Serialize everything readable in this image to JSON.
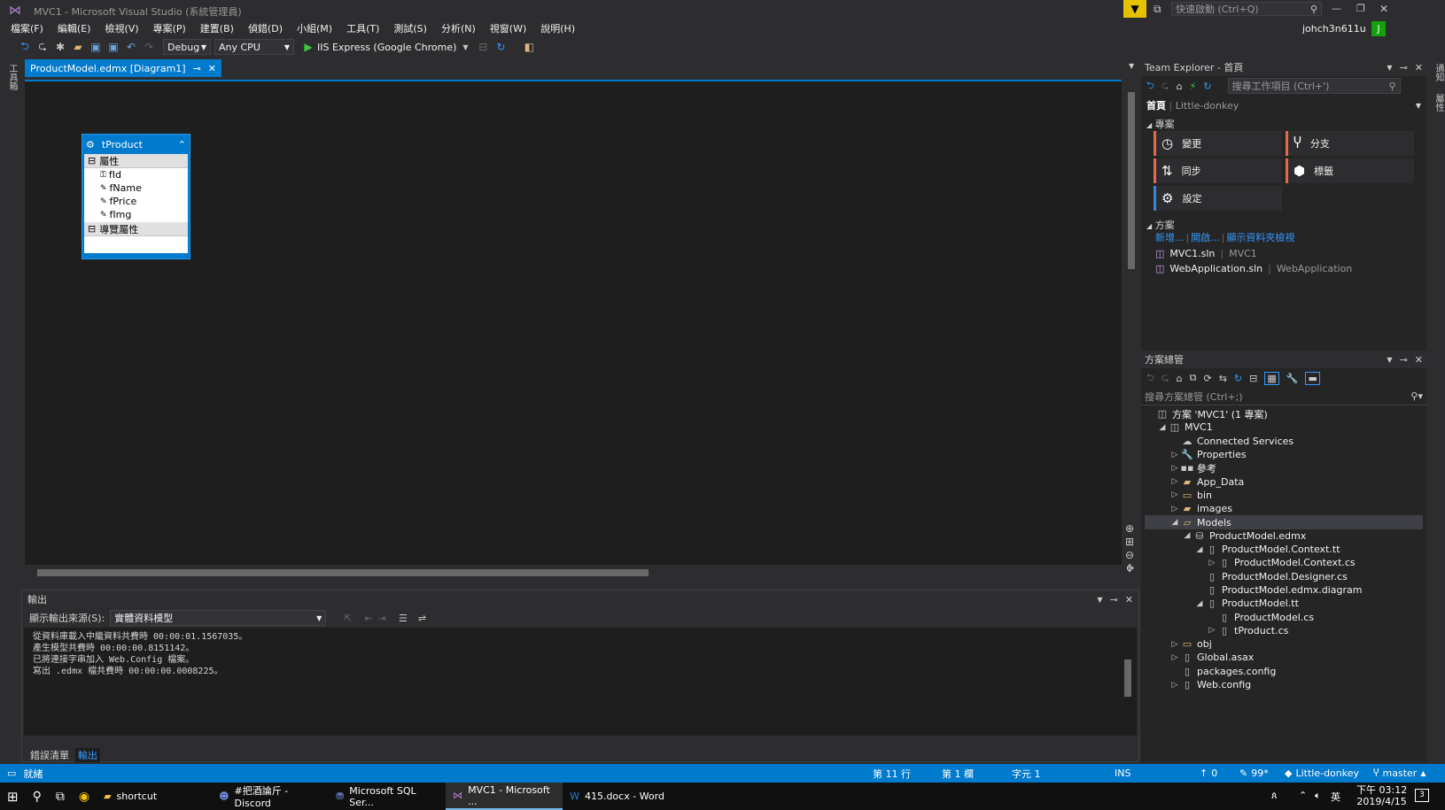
{
  "window": {
    "title": "MVC1 - Microsoft Visual Studio (系統管理員)",
    "quick_launch": "快速啟動 (Ctrl+Q)",
    "user": "johch3n611u",
    "user_initial": "J"
  },
  "menu": [
    "檔案(F)",
    "編輯(E)",
    "檢視(V)",
    "專案(P)",
    "建置(B)",
    "偵錯(D)",
    "小組(M)",
    "工具(T)",
    "測試(S)",
    "分析(N)",
    "視窗(W)",
    "說明(H)"
  ],
  "toolbar": {
    "config": "Debug",
    "platform": "Any CPU",
    "run": "IIS Express (Google Chrome)"
  },
  "left_strip": "工具箱",
  "document_tab": {
    "label": "ProductModel.edmx [Diagram1]"
  },
  "entity": {
    "name": "tProduct",
    "section_props": "屬性",
    "props": [
      "fId",
      "fName",
      "fPrice",
      "fImg"
    ],
    "section_nav": "導覽屬性"
  },
  "output": {
    "title": "輸出",
    "source_label": "顯示輸出來源(S):",
    "source_value": "實體資料模型",
    "lines": [
      "從資料庫載入中繼資料共費時 00:00:01.1567035。",
      "產生模型共費時 00:00:00.8151142。",
      "已將連接字串加入 Web.Config 檔案。",
      "寫出 .edmx 檔共費時 00:00:00.0008225。"
    ],
    "tabs": [
      "錯誤清單",
      "輸出"
    ]
  },
  "team_explorer": {
    "title": "Team Explorer - 首頁",
    "search_placeholder": "搜尋工作項目 (Ctrl+')",
    "home": "首頁",
    "repo": "Little-donkey",
    "project_header": "專案",
    "tiles": [
      {
        "label": "變更",
        "icon": "clock-icon",
        "color": "#e8694a"
      },
      {
        "label": "分支",
        "icon": "branch-icon",
        "color": "#e8694a"
      },
      {
        "label": "同步",
        "icon": "sync-icon",
        "color": "#e8694a"
      },
      {
        "label": "標籤",
        "icon": "tag-icon",
        "color": "#e8694a"
      },
      {
        "label": "設定",
        "icon": "gear-icon",
        "color": "#3b87d6"
      }
    ],
    "solutions_header": "方案",
    "sol_links": [
      "新增...",
      "開啟...",
      "顯示資料夾檢視"
    ],
    "solutions": [
      {
        "name": "MVC1.sln",
        "path": "MVC1"
      },
      {
        "name": "WebApplication.sln",
        "path": "WebApplication"
      }
    ]
  },
  "solution_explorer": {
    "title": "方案總管",
    "search_placeholder": "搜尋方案總管 (Ctrl+;)",
    "items": [
      {
        "label": "方案 'MVC1' (1 專案)",
        "depth": 0,
        "exp": "",
        "icon": "solution-icon"
      },
      {
        "label": "MVC1",
        "depth": 1,
        "exp": "◢",
        "icon": "project-icon"
      },
      {
        "label": "Connected Services",
        "depth": 2,
        "exp": "",
        "icon": "cloud-icon"
      },
      {
        "label": "Properties",
        "depth": 2,
        "exp": "▷",
        "icon": "wrench-icon"
      },
      {
        "label": "參考",
        "depth": 2,
        "exp": "▷",
        "icon": "references-icon"
      },
      {
        "label": "App_Data",
        "depth": 2,
        "exp": "▷",
        "icon": "folder-icon"
      },
      {
        "label": "bin",
        "depth": 2,
        "exp": "▷",
        "icon": "folder-outline-icon"
      },
      {
        "label": "images",
        "depth": 2,
        "exp": "▷",
        "icon": "folder-icon"
      },
      {
        "label": "Models",
        "depth": 2,
        "exp": "◢",
        "icon": "folder-open-icon"
      },
      {
        "label": "ProductModel.edmx",
        "depth": 3,
        "exp": "◢",
        "icon": "edmx-icon"
      },
      {
        "label": "ProductModel.Context.tt",
        "depth": 4,
        "exp": "◢",
        "icon": "file-icon"
      },
      {
        "label": "ProductModel.Context.cs",
        "depth": 5,
        "exp": "▷",
        "icon": "file-icon"
      },
      {
        "label": "ProductModel.Designer.cs",
        "depth": 4,
        "exp": "",
        "icon": "file-icon"
      },
      {
        "label": "ProductModel.edmx.diagram",
        "depth": 4,
        "exp": "",
        "icon": "file-icon"
      },
      {
        "label": "ProductModel.tt",
        "depth": 4,
        "exp": "◢",
        "icon": "file-icon"
      },
      {
        "label": "ProductModel.cs",
        "depth": 5,
        "exp": "",
        "icon": "file-icon"
      },
      {
        "label": "tProduct.cs",
        "depth": 5,
        "exp": "▷",
        "icon": "file-icon"
      },
      {
        "label": "obj",
        "depth": 2,
        "exp": "▷",
        "icon": "folder-outline-icon"
      },
      {
        "label": "Global.asax",
        "depth": 2,
        "exp": "▷",
        "icon": "file-icon"
      },
      {
        "label": "packages.config",
        "depth": 2,
        "exp": "",
        "icon": "file-icon"
      },
      {
        "label": "Web.config",
        "depth": 2,
        "exp": "▷",
        "icon": "file-icon"
      }
    ]
  },
  "right_strip": "通知",
  "right_strip2": "屬性",
  "status": {
    "ready": "就緒",
    "line": "第 11 行",
    "col": "第 1 欄",
    "ch": "字元 1",
    "ins": "INS",
    "up": "0",
    "changes": "99*",
    "repo": "Little-donkey",
    "branch": "master"
  },
  "taskbar": {
    "items": [
      {
        "label": "shortcut",
        "icon": "folder-icon"
      },
      {
        "label": "#把酒論斤 - Discord",
        "icon": "discord-icon"
      },
      {
        "label": "Microsoft SQL Ser...",
        "icon": "sql-icon"
      },
      {
        "label": "MVC1 - Microsoft ...",
        "icon": "vs-icon"
      },
      {
        "label": "415.docx - Word",
        "icon": "word-icon"
      }
    ],
    "time": "下午 03:12",
    "date": "2019/4/15",
    "ime": "英",
    "notif_count": "3"
  }
}
